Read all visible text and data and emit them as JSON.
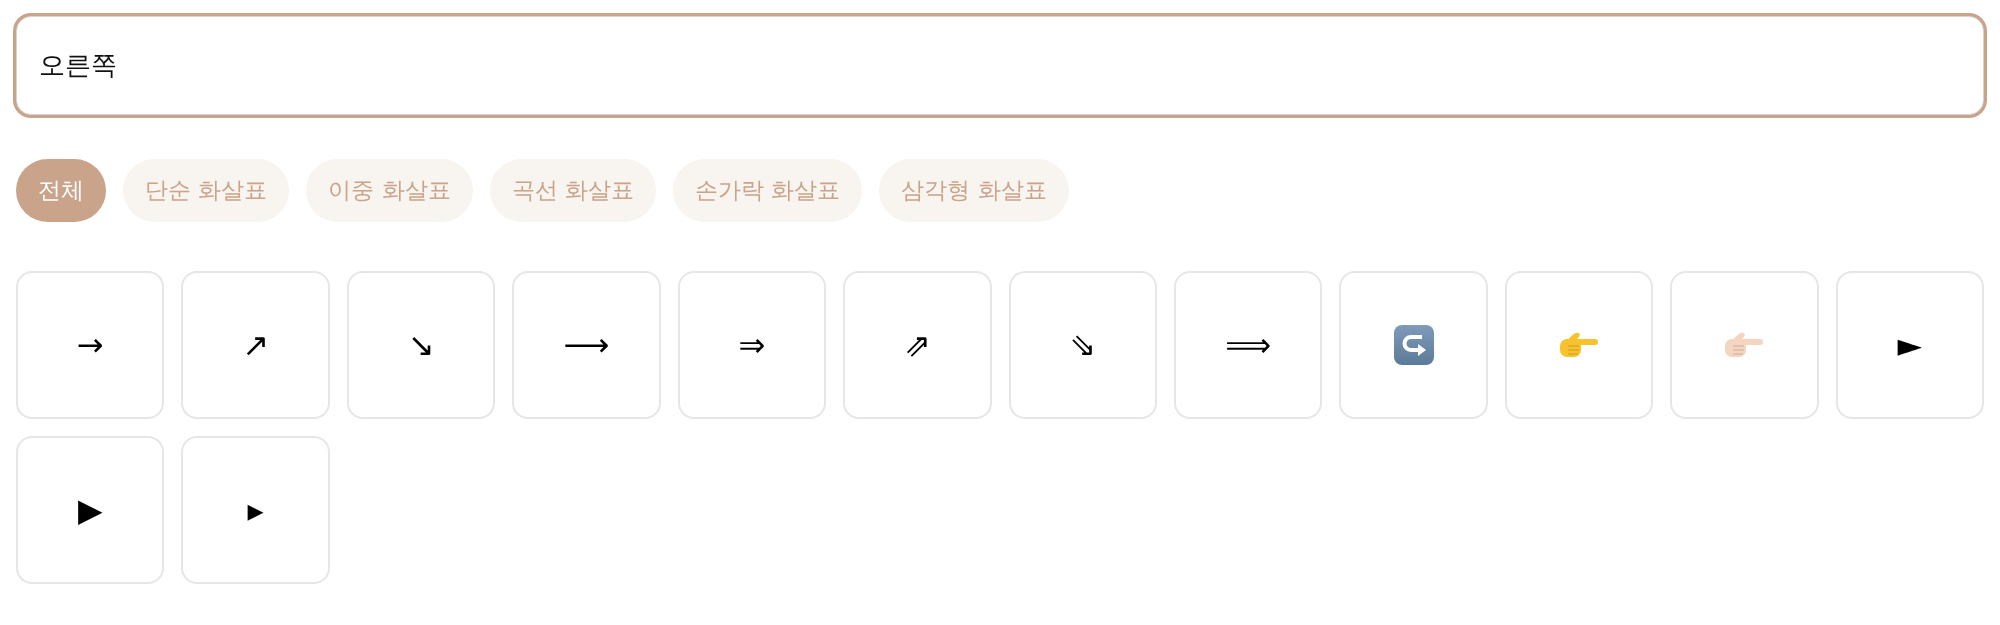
{
  "search": {
    "value": "오른쪽"
  },
  "tabs": [
    {
      "label": "전체",
      "selected": true
    },
    {
      "label": "단순 화살표",
      "selected": false
    },
    {
      "label": "이중 화살표",
      "selected": false
    },
    {
      "label": "곡선 화살표",
      "selected": false
    },
    {
      "label": "손가락 화살표",
      "selected": false
    },
    {
      "label": "삼각형 화살표",
      "selected": false
    }
  ],
  "symbols": [
    {
      "kind": "glyph",
      "symbol": "→"
    },
    {
      "kind": "glyph",
      "symbol": "↗"
    },
    {
      "kind": "glyph",
      "symbol": "↘"
    },
    {
      "kind": "glyph",
      "symbol": "⟶"
    },
    {
      "kind": "glyph",
      "symbol": "⇒"
    },
    {
      "kind": "glyph",
      "symbol": "⇗"
    },
    {
      "kind": "glyph",
      "symbol": "⇘"
    },
    {
      "kind": "glyph",
      "symbol": "⟹"
    },
    {
      "kind": "hook"
    },
    {
      "kind": "hand",
      "color": "#f7c22e"
    },
    {
      "kind": "hand",
      "color": "#f4d5c0"
    },
    {
      "kind": "glyph",
      "symbol": "►"
    },
    {
      "kind": "glyph",
      "symbol": "▶"
    },
    {
      "kind": "glyph",
      "symbol": "▸"
    }
  ]
}
